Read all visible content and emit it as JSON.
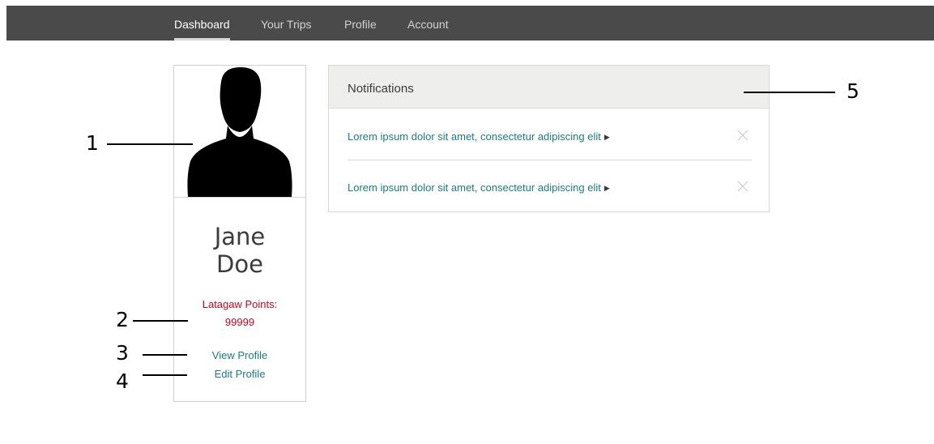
{
  "nav": {
    "items": [
      {
        "label": "Dashboard",
        "active": true
      },
      {
        "label": "Your Trips",
        "active": false
      },
      {
        "label": "Profile",
        "active": false
      },
      {
        "label": "Account",
        "active": false
      }
    ]
  },
  "profile": {
    "avatar_icon": "user-silhouette-icon",
    "first_name": "Jane",
    "last_name": "Doe",
    "points_label": "Latagaw Points:",
    "points_value": "99999",
    "view_profile": "View Profile",
    "edit_profile": "Edit Profile"
  },
  "notifications": {
    "title": "Notifications",
    "items": [
      {
        "text": "Lorem ipsum dolor sit amet, consectetur adipiscing elit",
        "arrow_icon": "triangle-right-icon",
        "close_icon": "close-icon"
      },
      {
        "text": "Lorem ipsum dolor sit amet, consectetur adipiscing elit",
        "arrow_icon": "triangle-right-icon",
        "close_icon": "close-icon"
      }
    ]
  },
  "callouts": [
    "1",
    "2",
    "3",
    "4",
    "5"
  ],
  "colors": {
    "topbar": "#4a4a4a",
    "points": "#d0021b",
    "link": "#1a7d7d",
    "header_bg": "#eeeeec"
  }
}
